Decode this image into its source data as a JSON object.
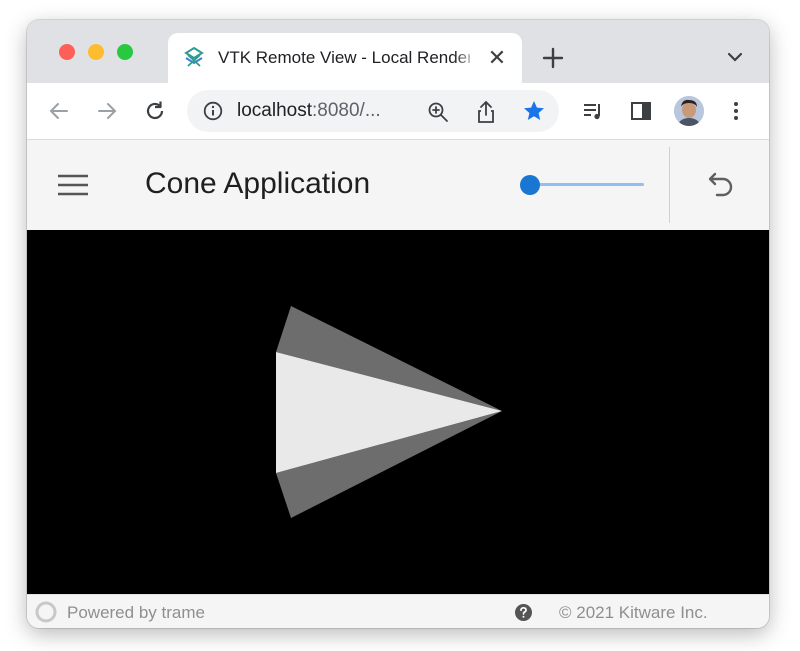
{
  "browser": {
    "tab": {
      "title": "VTK Remote View - Local Rendering",
      "favicon": "vtk-favicon",
      "close_symbol": "✕"
    },
    "toolbar": {
      "url_host": "localhost",
      "url_rest": ":8080/...",
      "bookmark_color": "#1a73e8"
    }
  },
  "app": {
    "title": "Cone Application",
    "resolution_slider": {
      "value": 0.0,
      "accent": "#1976d2",
      "track": "#8ec0f5"
    },
    "icons": {
      "menu": "menu-icon",
      "reset": "undo-icon"
    }
  },
  "viewport": {
    "background": "#000000",
    "object": "cone"
  },
  "footer": {
    "powered_by": "Powered by trame",
    "copyright": "© 2021 Kitware Inc."
  }
}
